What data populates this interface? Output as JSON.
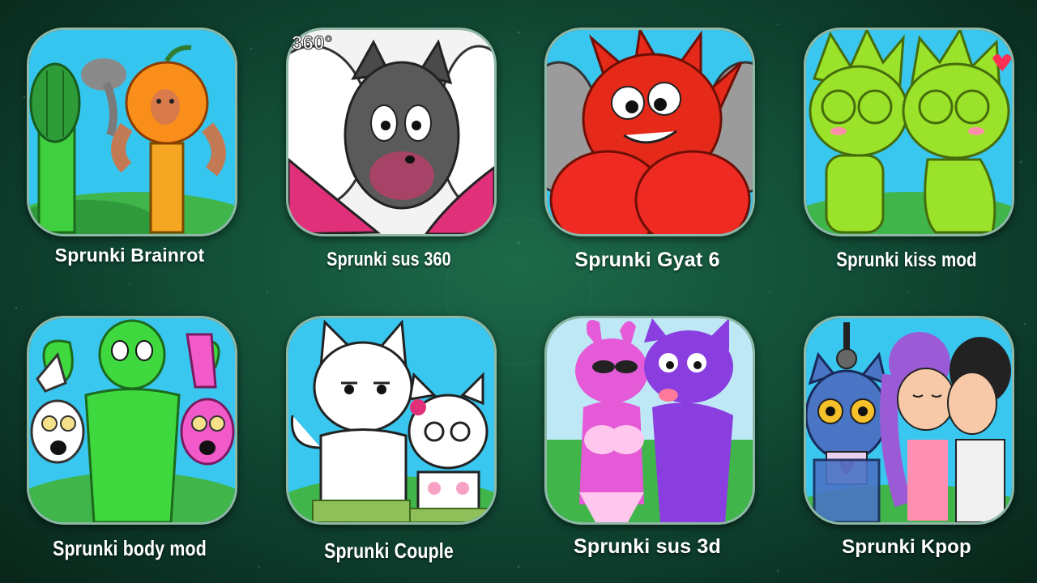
{
  "games": [
    {
      "title": "Sprunki Brainrot",
      "badge": ""
    },
    {
      "title": "Sprunki sus 360",
      "badge": "360°"
    },
    {
      "title": "Sprunki Gyat 6",
      "badge": ""
    },
    {
      "title": "Sprunki kiss mod",
      "badge": ""
    },
    {
      "title": "Sprunki body mod",
      "badge": ""
    },
    {
      "title": "Sprunki Couple",
      "badge": ""
    },
    {
      "title": "Sprunki sus 3d",
      "badge": ""
    },
    {
      "title": "Sprunki Kpop",
      "badge": ""
    }
  ],
  "colors": {
    "background": "#124d37",
    "tile_border": "#8fb8a6",
    "label_text": "#ffffff"
  }
}
